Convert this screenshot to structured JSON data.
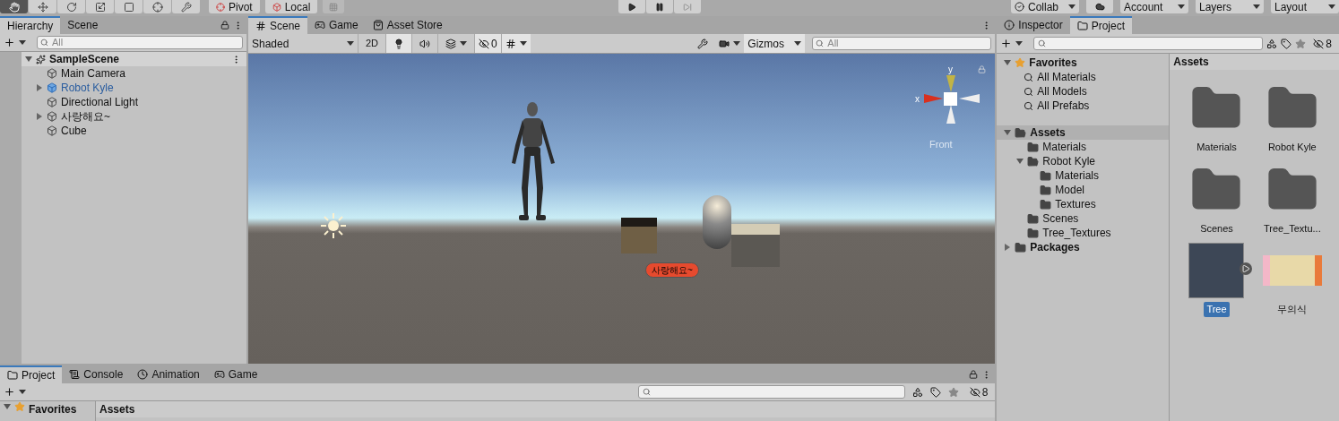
{
  "toolbar": {
    "tools": [
      {
        "kind": "hand",
        "selected": true
      },
      {
        "kind": "move",
        "selected": false
      },
      {
        "kind": "rotate",
        "selected": false
      },
      {
        "kind": "scale",
        "selected": false
      },
      {
        "kind": "rect",
        "selected": false
      },
      {
        "kind": "transform",
        "selected": false
      },
      {
        "kind": "custom",
        "selected": false
      }
    ],
    "pivot": "Pivot",
    "local": "Local",
    "right_buttons": [
      {
        "kind": "collab",
        "label": "Collab"
      },
      {
        "kind": "cloud"
      },
      {
        "kind": "menu",
        "label": "Account"
      },
      {
        "kind": "menu",
        "label": "Layers"
      },
      {
        "kind": "menu",
        "label": "Layout"
      }
    ]
  },
  "hierarchy": {
    "tabs": [
      {
        "label": "Hierarchy",
        "selected": true
      },
      {
        "label": "Scene",
        "selected": false
      }
    ],
    "search": {
      "placeholder": "All"
    },
    "scene": "SampleScene",
    "items": [
      {
        "label": "Main Camera",
        "kind": "object",
        "expandable": false
      },
      {
        "label": "Robot Kyle",
        "kind": "prefab",
        "expandable": true
      },
      {
        "label": "Directional Light",
        "kind": "object",
        "expandable": false
      },
      {
        "label": "사랑해요~",
        "kind": "object",
        "expandable": true
      },
      {
        "label": "Cube",
        "kind": "object",
        "expandable": false
      }
    ]
  },
  "scene_view": {
    "tabs": [
      {
        "label": "Scene",
        "kind": "scene",
        "selected": true
      },
      {
        "label": "Game",
        "kind": "game",
        "selected": false
      },
      {
        "label": "Asset Store",
        "kind": "store",
        "selected": false
      }
    ],
    "shading": "Shaded",
    "mode_2d": "2D",
    "hidden_count": "0",
    "gizmos": "Gizmos",
    "search": {
      "placeholder": "All"
    },
    "gizmo": {
      "y_label": "y",
      "x_label": "x",
      "view_label": "Front"
    },
    "world_label": "사랑해요~"
  },
  "right_panel": {
    "tabs": [
      {
        "label": "Inspector",
        "kind": "info",
        "selected": false
      },
      {
        "label": "Project",
        "kind": "folder",
        "selected": true
      }
    ],
    "hidden_count": "8",
    "favorites": {
      "title": "Favorites",
      "items": [
        "All Materials",
        "All Models",
        "All Prefabs"
      ]
    },
    "tree": [
      {
        "label": "Assets",
        "expanded": true,
        "selected": true,
        "children": [
          {
            "label": "Materials"
          },
          {
            "label": "Robot Kyle",
            "expanded": true,
            "selected": false,
            "children": [
              {
                "label": "Materials"
              },
              {
                "label": "Model"
              },
              {
                "label": "Textures"
              }
            ]
          },
          {
            "label": "Scenes"
          },
          {
            "label": "Tree_Textures"
          }
        ]
      },
      {
        "label": "Packages",
        "expanded": false,
        "selected": false
      }
    ],
    "grid_title": "Assets",
    "grid": [
      {
        "label": "Materials",
        "kind": "folder",
        "selected": false
      },
      {
        "label": "Robot Kyle",
        "kind": "folder",
        "selected": false
      },
      {
        "label": "Scenes",
        "kind": "folder",
        "selected": false
      },
      {
        "label": "Tree_Textu...",
        "kind": "folder",
        "selected": false
      },
      {
        "label": "Tree",
        "kind": "model",
        "selected": true
      },
      {
        "label": "무의식",
        "kind": "texture",
        "selected": false
      }
    ]
  },
  "bottom_panel": {
    "tabs": [
      {
        "label": "Project",
        "kind": "folder",
        "selected": true
      },
      {
        "label": "Console",
        "kind": "console",
        "selected": false
      },
      {
        "label": "Animation",
        "kind": "animation",
        "selected": false
      },
      {
        "label": "Game",
        "kind": "game",
        "selected": false
      }
    ],
    "hidden_count": "8",
    "favorites": "Favorites",
    "assets": "Assets"
  }
}
